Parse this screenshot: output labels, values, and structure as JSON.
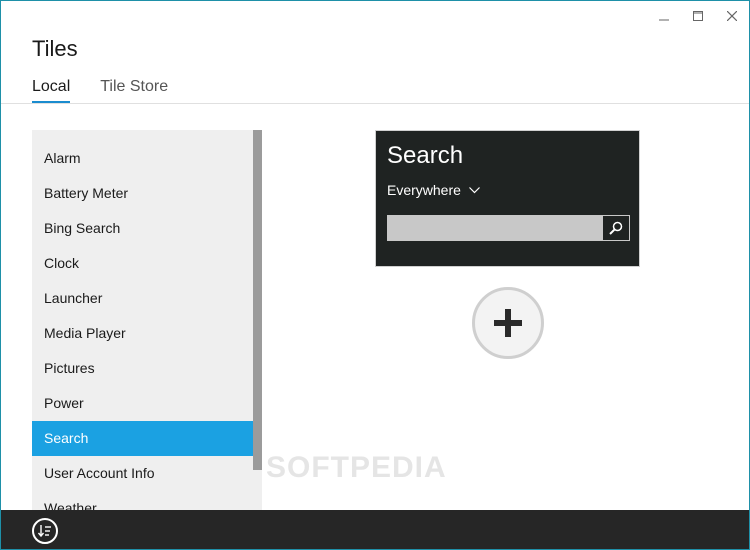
{
  "window": {
    "title": "Tiles",
    "controls": {
      "minimize": "minimize",
      "maximize": "maximize",
      "close": "close"
    }
  },
  "tabs": [
    {
      "label": "Local",
      "active": true
    },
    {
      "label": "Tile Store",
      "active": false
    }
  ],
  "list": {
    "items": [
      {
        "label": "Alarm"
      },
      {
        "label": "Battery Meter"
      },
      {
        "label": "Bing Search"
      },
      {
        "label": "Clock"
      },
      {
        "label": "Launcher"
      },
      {
        "label": "Media Player"
      },
      {
        "label": "Pictures"
      },
      {
        "label": "Power"
      },
      {
        "label": "Search"
      },
      {
        "label": "User Account Info"
      },
      {
        "label": "Weather"
      }
    ],
    "selected": "Search"
  },
  "tile": {
    "title": "Search",
    "scope": "Everywhere",
    "search_value": "",
    "background": "#1f2322"
  },
  "watermark": "SOFTPEDIA",
  "colors": {
    "accent": "#1ba1e2",
    "tab_underline": "#1a8ccf",
    "bottom_bar": "#262626"
  },
  "icons": {
    "tile_search": "magnifier-icon",
    "add": "plus-icon",
    "bottom": "sort-down-icon"
  }
}
